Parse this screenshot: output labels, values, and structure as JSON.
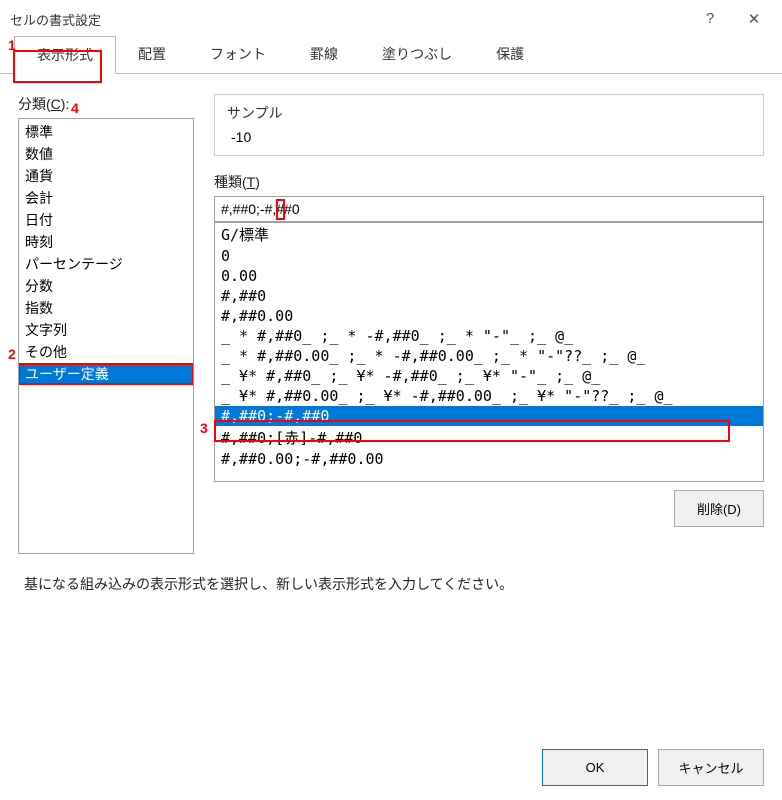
{
  "title": "セルの書式設定",
  "titlebar": {
    "help": "?",
    "close": "✕"
  },
  "tabs": {
    "items": [
      {
        "label": "表示形式"
      },
      {
        "label": "配置"
      },
      {
        "label": "フォント"
      },
      {
        "label": "罫線"
      },
      {
        "label": "塗りつぶし"
      },
      {
        "label": "保護"
      }
    ]
  },
  "category": {
    "label_prefix": "分類(",
    "label_underline": "C",
    "label_suffix": "):",
    "items": [
      "標準",
      "数値",
      "通貨",
      "会計",
      "日付",
      "時刻",
      "パーセンテージ",
      "分数",
      "指数",
      "文字列",
      "その他",
      "ユーザー定義"
    ],
    "selected_index": 11
  },
  "sample": {
    "label": "サンプル",
    "value": "-10"
  },
  "type": {
    "label_prefix": "種類(",
    "label_underline": "T",
    "label_suffix": ")",
    "input_value": "#,##0;-#,##0",
    "items": [
      "G/標準",
      "0",
      "0.00",
      "#,##0",
      "#,##0.00",
      "_ * #,##0_ ;_  * -#,##0_ ;_  * \"-\"_ ;_  @_ ",
      "_ * #,##0.00_ ;_  * -#,##0.00_ ;_  * \"-\"??_  ;_  @_ ",
      "_ ¥* #,##0_ ;_  ¥* -#,##0_ ;_  ¥* \"-\"_ ;_  @_ ",
      "_ ¥* #,##0.00_ ;_  ¥* -#,##0.00_  ;_  ¥* \"-\"??_  ;_  @_",
      "#,##0;-#,##0",
      "#,##0;[赤]-#,##0",
      "#,##0.00;-#,##0.00"
    ],
    "selected_index": 9
  },
  "delete_label": "削除(D)",
  "description": "基になる組み込みの表示形式を選択し、新しい表示形式を入力してください。",
  "footer": {
    "ok": "OK",
    "cancel": "キャンセル"
  },
  "annotations": {
    "n1": "1",
    "n2": "2",
    "n3": "3",
    "n4": "4"
  }
}
